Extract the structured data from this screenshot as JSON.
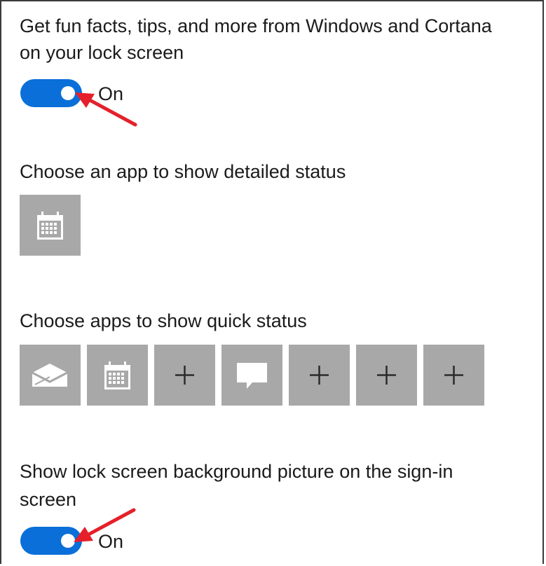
{
  "tips_setting": {
    "label_line1": "Get fun facts, tips, and more from Windows and Cortana",
    "label_line2": "on your lock screen",
    "toggle_state": "On"
  },
  "detailed_status": {
    "heading": "Choose an app to show detailed status",
    "app": {
      "icon": "calendar-icon"
    }
  },
  "quick_status": {
    "heading": "Choose apps to show quick status",
    "apps": [
      {
        "icon": "mail-icon"
      },
      {
        "icon": "calendar-icon"
      },
      {
        "icon": "plus-icon"
      },
      {
        "icon": "chat-icon"
      },
      {
        "icon": "plus-icon"
      },
      {
        "icon": "plus-icon"
      },
      {
        "icon": "plus-icon"
      }
    ]
  },
  "background_setting": {
    "label_line1": "Show lock screen background picture on the sign-in",
    "label_line2": "screen",
    "toggle_state": "On"
  },
  "colors": {
    "toggle_on": "#0a6fd8",
    "tile_background": "#a8a8a8",
    "annotation_arrow": "#e5202a"
  }
}
